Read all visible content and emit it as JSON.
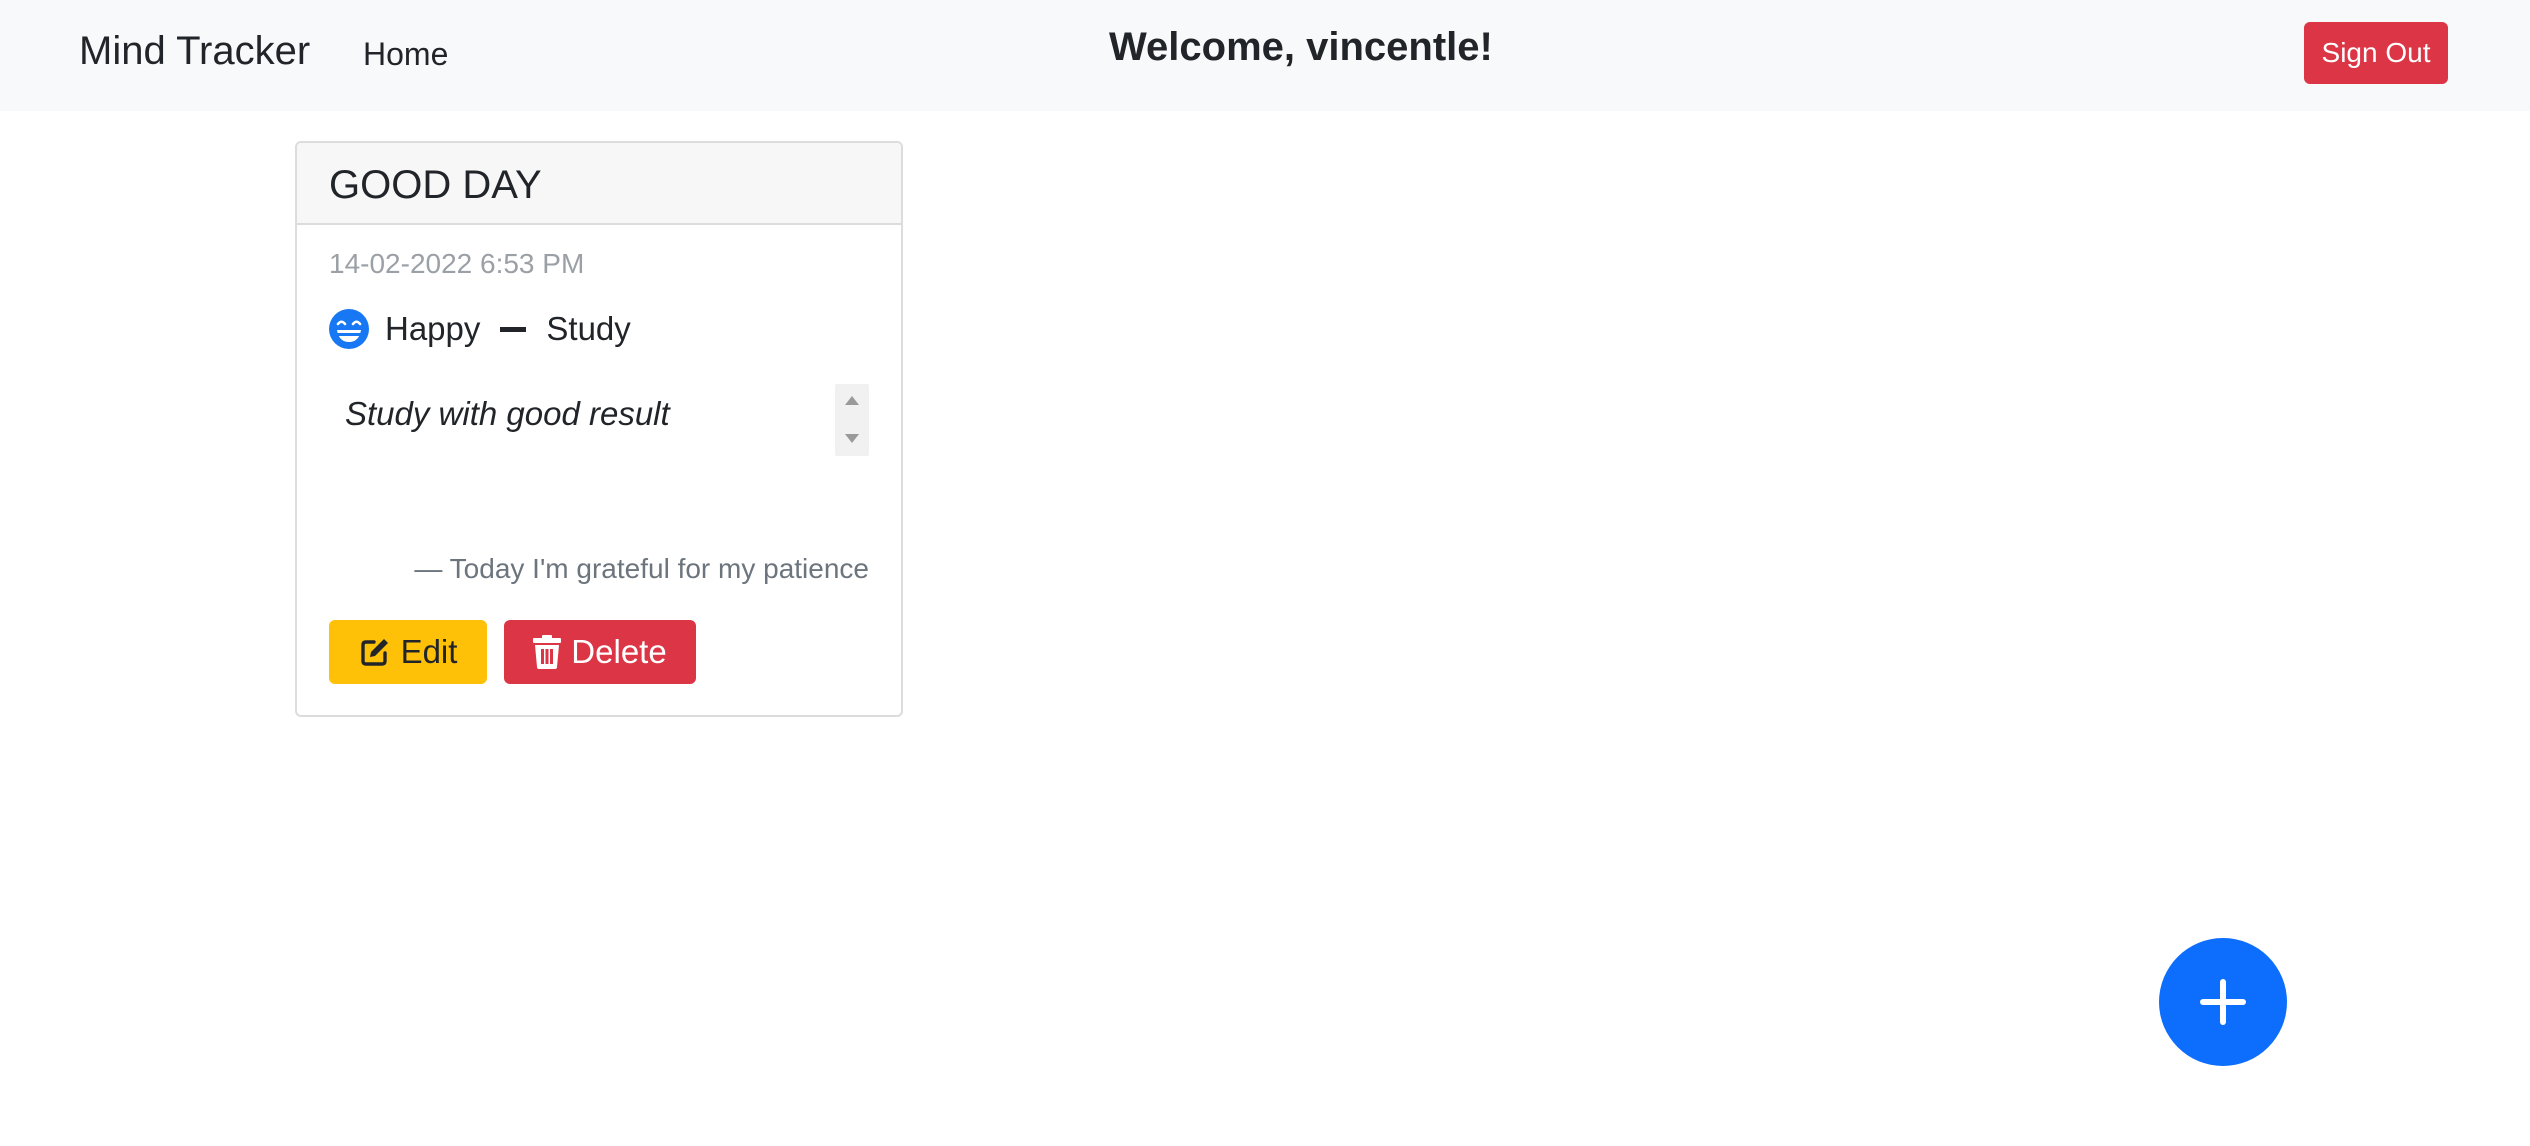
{
  "navbar": {
    "brand": "Mind Tracker",
    "home_label": "Home",
    "welcome": "Welcome, vincentle!",
    "signout_label": "Sign Out"
  },
  "entry": {
    "title": "GOOD DAY",
    "datetime": "14-02-2022 6:53 PM",
    "mood": "Happy",
    "mood_icon": "grinning-face-icon",
    "activity": "Study",
    "note": "Study with good result",
    "grateful": "— Today I'm grateful for my patience",
    "edit_label": "Edit",
    "delete_label": "Delete"
  },
  "fab": {
    "icon": "plus-icon"
  },
  "colors": {
    "navbar_bg": "#f8f9fa",
    "danger": "#dc3545",
    "warning": "#ffc107",
    "primary": "#0d6efd",
    "mood_icon": "#1878f3"
  }
}
